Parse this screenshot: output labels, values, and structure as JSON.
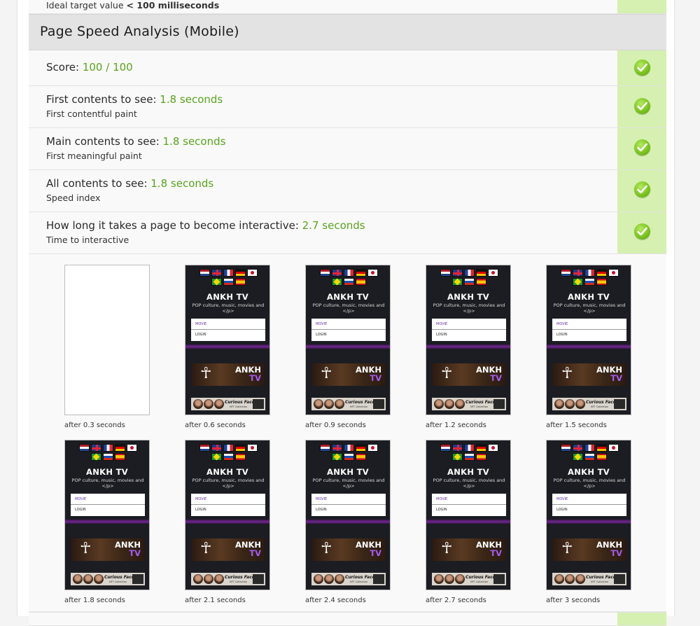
{
  "top_remnant": {
    "label": "Ideal target value",
    "value": "< 100 milliseconds"
  },
  "section": {
    "title": "Page Speed Analysis (Mobile)"
  },
  "metrics": [
    {
      "label": "Score:",
      "value": "100 / 100",
      "sub": "",
      "status_icon": "check-icon"
    },
    {
      "label": "First contents to see:",
      "value": "1.8 seconds",
      "sub": "First contentful paint",
      "status_icon": "check-icon"
    },
    {
      "label": "Main contents to see:",
      "value": "1.8 seconds",
      "sub": "First meaningful paint",
      "status_icon": "check-icon"
    },
    {
      "label": "All contents to see:",
      "value": "1.8 seconds",
      "sub": "Speed index",
      "status_icon": "check-icon"
    },
    {
      "label": "How long it takes a page to become interactive:",
      "value": "2.7 seconds",
      "sub": "Time to interactive",
      "status_icon": "check-icon"
    }
  ],
  "colors": {
    "value_green": "#5aa31e",
    "status_bg": "#d5f0b0",
    "header_bg": "#e3e3e3"
  },
  "site_preview": {
    "title": "ANKH TV",
    "subtitle": "POP culture, music, movies and </p>",
    "menu_item_1": "MOVIE",
    "menu_item_2": "LOGIN",
    "banner_line_1": "ANKH",
    "banner_line_2": "TV",
    "banner_symbol": "☥",
    "footer_title": "Curious Faces",
    "footer_sub": "NFT Collection"
  },
  "filmstrip": [
    {
      "caption": "after 0.3 seconds",
      "loaded": false
    },
    {
      "caption": "after 0.6 seconds",
      "loaded": true
    },
    {
      "caption": "after 0.9 seconds",
      "loaded": true
    },
    {
      "caption": "after 1.2 seconds",
      "loaded": true
    },
    {
      "caption": "after 1.5 seconds",
      "loaded": true
    },
    {
      "caption": "after 1.8 seconds",
      "loaded": true
    },
    {
      "caption": "after 2.1 seconds",
      "loaded": true
    },
    {
      "caption": "after 2.4 seconds",
      "loaded": true
    },
    {
      "caption": "after 2.7 seconds",
      "loaded": true
    },
    {
      "caption": "after 3 seconds",
      "loaded": true
    }
  ]
}
